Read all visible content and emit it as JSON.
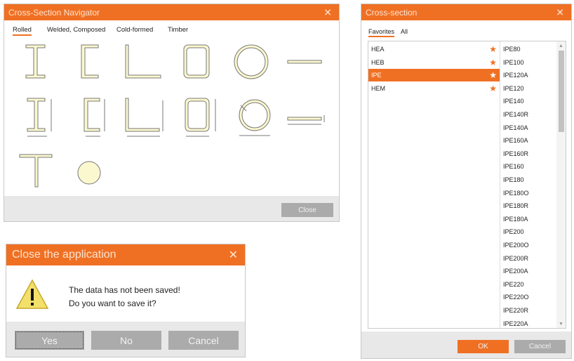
{
  "navigator": {
    "title": "Cross-Section Navigator",
    "tabs": [
      "Rolled",
      "Welded, Composed",
      "Cold-formed",
      "Timber"
    ],
    "close_label": "Close",
    "shapes": [
      "i-beam",
      "channel",
      "angle",
      "rectangular-hollow",
      "circular-hollow",
      "flat-bar",
      "i-beam-dimensioned",
      "channel-dimensioned",
      "angle-dimensioned",
      "rectangular-hollow-dimensioned",
      "circular-hollow-dimensioned",
      "flat-bar-dimensioned",
      "t-section",
      "round-bar"
    ]
  },
  "cross_section": {
    "title": "Cross-section",
    "tabs": [
      "Favorites",
      "All"
    ],
    "favorites": [
      {
        "label": "HEA",
        "selected": false
      },
      {
        "label": "HEB",
        "selected": false
      },
      {
        "label": "IPE",
        "selected": true
      },
      {
        "label": "HEM",
        "selected": false
      }
    ],
    "sections": [
      "IPE80",
      "IPE100",
      "IPE120A",
      "IPE120",
      "IPE140",
      "IPE140R",
      "IPE140A",
      "IPE160A",
      "IPE160R",
      "IPE160",
      "IPE180",
      "IPE180O",
      "IPE180R",
      "IPE180A",
      "IPE200",
      "IPE200O",
      "IPE200R",
      "IPE200A",
      "IPE220",
      "IPE220O",
      "IPE220R",
      "IPE220A"
    ],
    "ok_label": "OK",
    "cancel_label": "Cancel"
  },
  "close_dialog": {
    "title": "Close the application",
    "line1": "The data has not been saved!",
    "line2": "Do you want to save it?",
    "yes_label": "Yes",
    "no_label": "No",
    "cancel_label": "Cancel"
  },
  "colors": {
    "accent": "#f07023",
    "button": "#ababab"
  }
}
